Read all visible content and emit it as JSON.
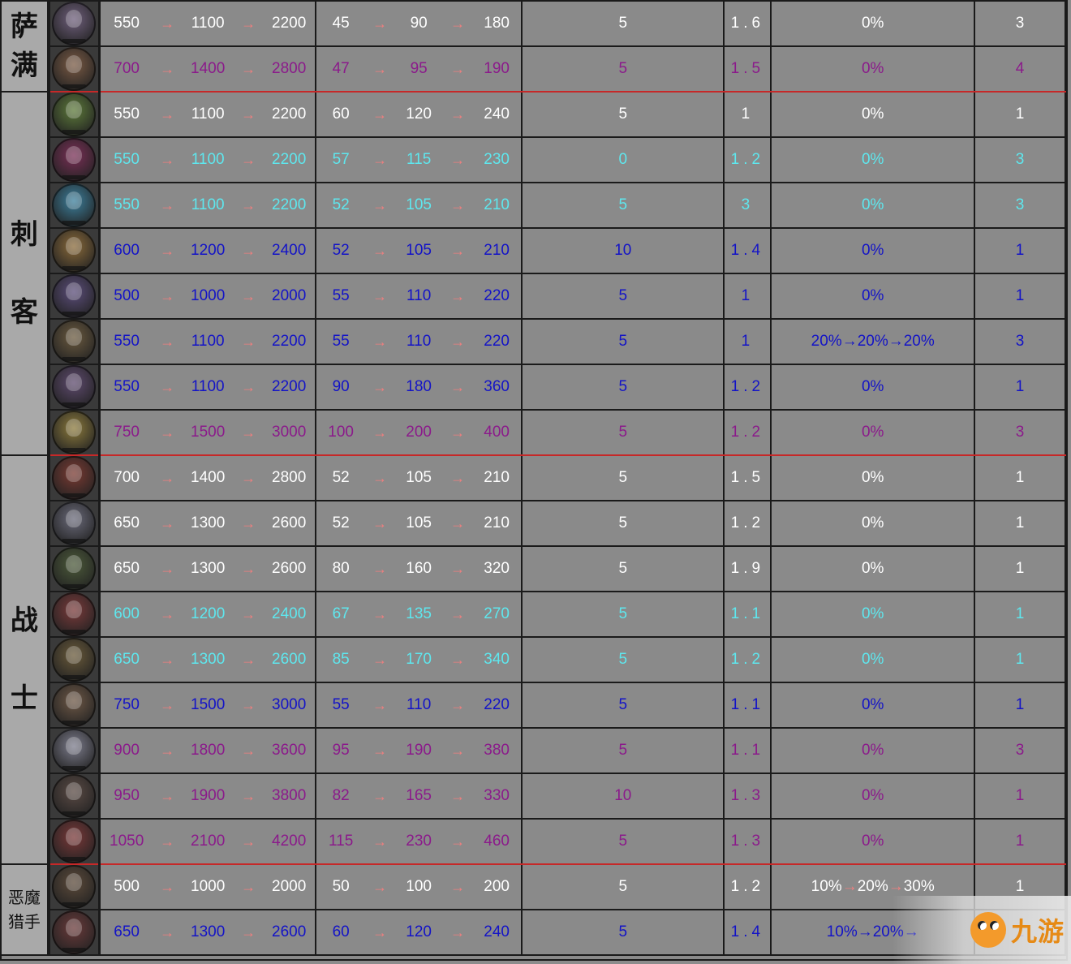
{
  "colors": {
    "white": "#ffffff",
    "purple": "#8b1a8b",
    "cyan": "#5ee7ee",
    "blue": "#1313c7",
    "arrow": "#f07f7f",
    "separator": "#c62828",
    "label_bg": "#a9a9a9",
    "cell_bg": "#8a8a8a"
  },
  "arrow_glyph": "→",
  "groups": [
    {
      "label_chars": [
        "萨",
        "满"
      ],
      "row_start": 0,
      "row_span": 2
    },
    {
      "label_chars": [
        "刺",
        "客"
      ],
      "row_start": 2,
      "row_span": 8
    },
    {
      "label_chars": [
        "战",
        "士"
      ],
      "row_start": 10,
      "row_span": 9
    },
    {
      "label_chars": [
        "恶魔",
        "猎手"
      ],
      "row_start": 19,
      "row_span": 2
    }
  ],
  "rows": [
    {
      "hp": [
        "550",
        "1100",
        "2200"
      ],
      "atk": [
        "45",
        "90",
        "180"
      ],
      "range": "5",
      "speed": "1.6",
      "crit": "0%",
      "cost": "3",
      "color": "white",
      "avatar_color": "#6f5f7c"
    },
    {
      "hp": [
        "700",
        "1400",
        "2800"
      ],
      "atk": [
        "47",
        "95",
        "190"
      ],
      "range": "5",
      "speed": "1.5",
      "crit": "0%",
      "cost": "4",
      "color": "purple",
      "avatar_color": "#7a5a44"
    },
    {
      "hp": [
        "550",
        "1100",
        "2200"
      ],
      "atk": [
        "60",
        "120",
        "240"
      ],
      "range": "5",
      "speed": "1",
      "crit": "0%",
      "cost": "1",
      "color": "white",
      "avatar_color": "#5d7a3a"
    },
    {
      "hp": [
        "550",
        "1100",
        "2200"
      ],
      "atk": [
        "57",
        "115",
        "230"
      ],
      "range": "0",
      "speed": "1.2",
      "crit": "0%",
      "cost": "3",
      "color": "cyan",
      "avatar_color": "#7a2f56"
    },
    {
      "hp": [
        "550",
        "1100",
        "2200"
      ],
      "atk": [
        "52",
        "105",
        "210"
      ],
      "range": "5",
      "speed": "3",
      "crit": "0%",
      "cost": "3",
      "color": "cyan",
      "avatar_color": "#3c7f9c"
    },
    {
      "hp": [
        "600",
        "1200",
        "2400"
      ],
      "atk": [
        "52",
        "105",
        "210"
      ],
      "range": "10",
      "speed": "1.4",
      "crit": "0%",
      "cost": "1",
      "color": "blue",
      "avatar_color": "#8a6a3a"
    },
    {
      "hp": [
        "500",
        "1000",
        "2000"
      ],
      "atk": [
        "55",
        "110",
        "220"
      ],
      "range": "5",
      "speed": "1",
      "crit": "0%",
      "cost": "1",
      "color": "blue",
      "avatar_color": "#5b4d7a"
    },
    {
      "hp": [
        "550",
        "1100",
        "2200"
      ],
      "atk": [
        "55",
        "110",
        "220"
      ],
      "range": "5",
      "speed": "1",
      "crit": [
        "20%",
        "20%",
        "20%"
      ],
      "cost": "3",
      "color": "blue",
      "avatar_color": "#6b5a3f"
    },
    {
      "hp": [
        "550",
        "1100",
        "2200"
      ],
      "atk": [
        "90",
        "180",
        "360"
      ],
      "range": "5",
      "speed": "1.2",
      "crit": "0%",
      "cost": "1",
      "color": "blue",
      "avatar_color": "#5e4a6e"
    },
    {
      "hp": [
        "750",
        "1500",
        "3000"
      ],
      "atk": [
        "100",
        "200",
        "400"
      ],
      "range": "5",
      "speed": "1.2",
      "crit": "0%",
      "cost": "3",
      "color": "purple",
      "avatar_color": "#8c7a3c"
    },
    {
      "hp": [
        "700",
        "1400",
        "2800"
      ],
      "atk": [
        "52",
        "105",
        "210"
      ],
      "range": "5",
      "speed": "1.5",
      "crit": "0%",
      "cost": "1",
      "color": "white",
      "avatar_color": "#7a3a32"
    },
    {
      "hp": [
        "650",
        "1300",
        "2600"
      ],
      "atk": [
        "52",
        "105",
        "210"
      ],
      "range": "5",
      "speed": "1.2",
      "crit": "0%",
      "cost": "1",
      "color": "white",
      "avatar_color": "#6a6a7a"
    },
    {
      "hp": [
        "650",
        "1300",
        "2600"
      ],
      "atk": [
        "80",
        "160",
        "320"
      ],
      "range": "5",
      "speed": "1.9",
      "crit": "0%",
      "cost": "1",
      "color": "white",
      "avatar_color": "#4c5a3a"
    },
    {
      "hp": [
        "600",
        "1200",
        "2400"
      ],
      "atk": [
        "67",
        "135",
        "270"
      ],
      "range": "5",
      "speed": "1.1",
      "crit": "0%",
      "cost": "1",
      "color": "cyan",
      "avatar_color": "#7a3a3a"
    },
    {
      "hp": [
        "650",
        "1300",
        "2600"
      ],
      "atk": [
        "85",
        "170",
        "340"
      ],
      "range": "5",
      "speed": "1.2",
      "crit": "0%",
      "cost": "1",
      "color": "cyan",
      "avatar_color": "#6a5a3a"
    },
    {
      "hp": [
        "750",
        "1500",
        "3000"
      ],
      "atk": [
        "55",
        "110",
        "220"
      ],
      "range": "5",
      "speed": "1.1",
      "crit": "0%",
      "cost": "1",
      "color": "blue",
      "avatar_color": "#6e5846"
    },
    {
      "hp": [
        "900",
        "1800",
        "3600"
      ],
      "atk": [
        "95",
        "190",
        "380"
      ],
      "range": "5",
      "speed": "1.1",
      "crit": "0%",
      "cost": "3",
      "color": "purple",
      "avatar_color": "#7c7c8c"
    },
    {
      "hp": [
        "950",
        "1900",
        "3800"
      ],
      "atk": [
        "82",
        "165",
        "330"
      ],
      "range": "10",
      "speed": "1.3",
      "crit": "0%",
      "cost": "1",
      "color": "purple",
      "avatar_color": "#5a4a44"
    },
    {
      "hp": [
        "1050",
        "2100",
        "4200"
      ],
      "atk": [
        "115",
        "230",
        "460"
      ],
      "range": "5",
      "speed": "1.3",
      "crit": "0%",
      "cost": "1",
      "color": "purple",
      "avatar_color": "#7a3838"
    },
    {
      "hp": [
        "500",
        "1000",
        "2000"
      ],
      "atk": [
        "50",
        "100",
        "200"
      ],
      "range": "5",
      "speed": "1.2",
      "crit": [
        "10%",
        "20%",
        "30%"
      ],
      "cost": "1",
      "color": "white",
      "avatar_color": "#5c4a3a",
      "crit_soft_arrows": true
    },
    {
      "hp": [
        "650",
        "1300",
        "2600"
      ],
      "atk": [
        "60",
        "120",
        "240"
      ],
      "range": "5",
      "speed": "1.4",
      "crit": [
        "10%",
        "20%",
        ""
      ],
      "cost": "1",
      "color": "blue",
      "avatar_color": "#6a3a3a"
    }
  ],
  "watermark": {
    "text": "九游",
    "mascot": "orange-mascot-icon"
  }
}
